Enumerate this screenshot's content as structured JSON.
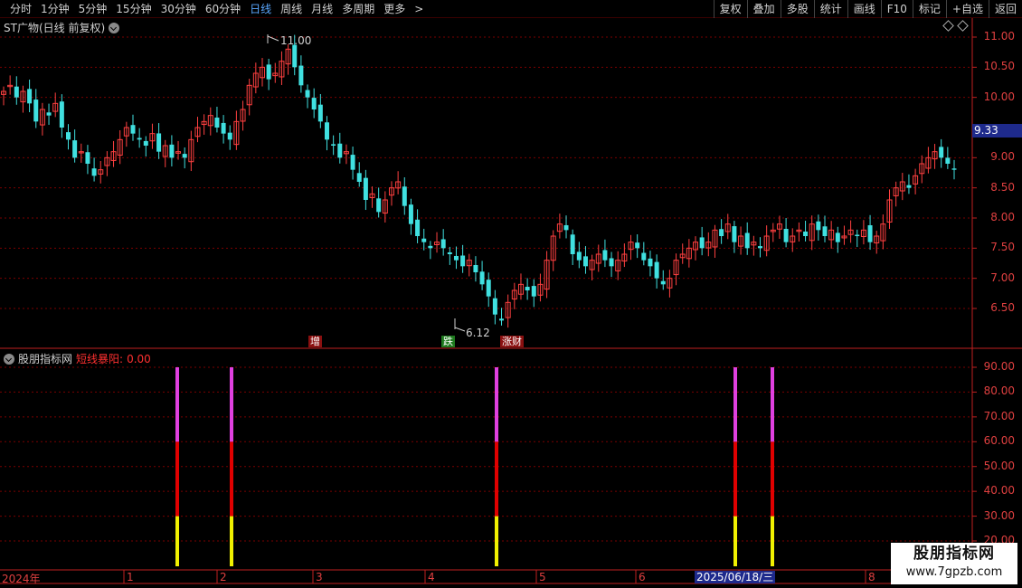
{
  "toolbar": {
    "periods": [
      "分时",
      "1分钟",
      "5分钟",
      "15分钟",
      "30分钟",
      "60分钟",
      "日线",
      "周线",
      "月线",
      "多周期",
      "更多"
    ],
    "active_period": "日线",
    "more_arrow": ">",
    "tools": [
      "复权",
      "叠加",
      "多股",
      "统计",
      "画线",
      "F10",
      "标记",
      "+自选",
      "返回"
    ]
  },
  "main_chart": {
    "title": "ST广物(日线 前复权)",
    "price_ticks": [
      "11.00",
      "10.50",
      "10.00",
      "9.33",
      "9.00",
      "8.50",
      "8.00",
      "7.50",
      "7.00",
      "6.50"
    ],
    "current_price": "9.33",
    "high_marker": "11.00",
    "low_marker": "6.12",
    "badges": [
      {
        "text": "增",
        "color": "#c82828"
      },
      {
        "text": "跌",
        "color": "#1e8c1e"
      },
      {
        "text": "涨财",
        "color": "#c82828"
      }
    ]
  },
  "indicator": {
    "name": "股朋指标网",
    "line_name": "短线暴阳:",
    "line_value": "0.00",
    "ticks": [
      "90.00",
      "80.00",
      "70.00",
      "60.00",
      "50.00",
      "40.00",
      "30.00",
      "20.00"
    ]
  },
  "time_axis": {
    "labels": [
      "2024年",
      "1",
      "2",
      "3",
      "4",
      "5",
      "6",
      "7",
      "8"
    ],
    "cursor_date": "2025/06/18/三"
  },
  "watermark": {
    "title": "股朋指标网",
    "url": "www.7gpzb.com"
  },
  "colors": {
    "up": "#ff4040",
    "down": "#40e0e0",
    "grid": "#7a0000",
    "axis": "#c02020",
    "bar_top": "#e040e0",
    "bar_mid": "#e00000",
    "bar_low": "#f0f000"
  },
  "chart_data": {
    "type": "candlestick",
    "price_range": [
      6.12,
      11.0
    ],
    "indicator": {
      "type": "bar",
      "ylim": [
        20,
        90
      ],
      "signals": [
        {
          "value": 90,
          "segments": [
            30,
            60,
            90
          ]
        },
        {
          "value": 90,
          "segments": [
            30,
            60,
            90
          ]
        },
        {
          "value": 90,
          "segments": [
            30,
            60,
            90
          ]
        },
        {
          "value": 90,
          "segments": [
            30,
            60,
            90
          ]
        },
        {
          "value": 90,
          "segments": [
            30,
            60,
            90
          ]
        }
      ]
    }
  }
}
